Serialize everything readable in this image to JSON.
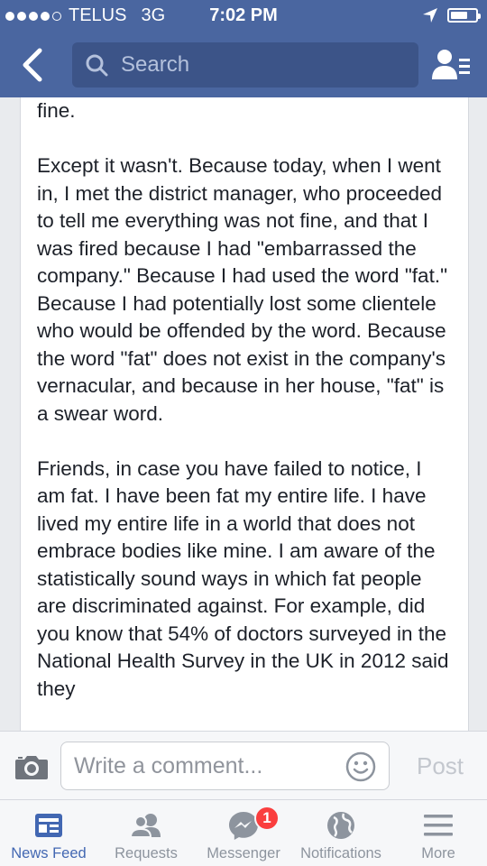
{
  "status_bar": {
    "carrier": "TELUS",
    "network": "3G",
    "time": "7:02 PM",
    "signal_dots_filled": 4,
    "signal_dots_total": 5,
    "battery_level": 0.7
  },
  "header": {
    "search_placeholder": "Search",
    "back_icon": "chevron-left-icon",
    "friends_icon": "friends-list-icon",
    "color": "#4a66a0"
  },
  "post": {
    "paragraphs": [
      "fine.",
      "Except it wasn't. Because today, when I went in, I met the district manager, who proceeded to tell me everything was not fine, and that I was fired because I had \"embarrassed the company.\" Because I had used the word \"fat.\" Because I had potentially lost some clientele who would be offended by the word. Because the word \"fat\" does not exist in the company's vernacular, and because in her house, \"fat\" is a swear word.",
      "Friends, in case you have failed to notice, I am fat. I have been fat my entire life. I have lived my entire life in a world that does not embrace bodies like mine. I am aware of the statistically sound ways in which fat people are discriminated against. For example, did you know that 54% of doctors surveyed in the National Health Survey in the UK in 2012 said they"
    ]
  },
  "comment_bar": {
    "placeholder": "Write a comment...",
    "post_label": "Post",
    "camera_icon": "camera-icon",
    "emoji_icon": "smiley-icon"
  },
  "tabs": [
    {
      "label": "News Feed",
      "icon": "news-feed-icon",
      "active": true
    },
    {
      "label": "Requests",
      "icon": "friend-requests-icon",
      "active": false
    },
    {
      "label": "Messenger",
      "icon": "messenger-icon",
      "active": false,
      "badge": "1"
    },
    {
      "label": "Notifications",
      "icon": "globe-icon",
      "active": false
    },
    {
      "label": "More",
      "icon": "menu-icon",
      "active": false
    }
  ],
  "colors": {
    "accent": "#4267b2",
    "badge": "#fa3e3e",
    "inactive": "#8d949e"
  }
}
